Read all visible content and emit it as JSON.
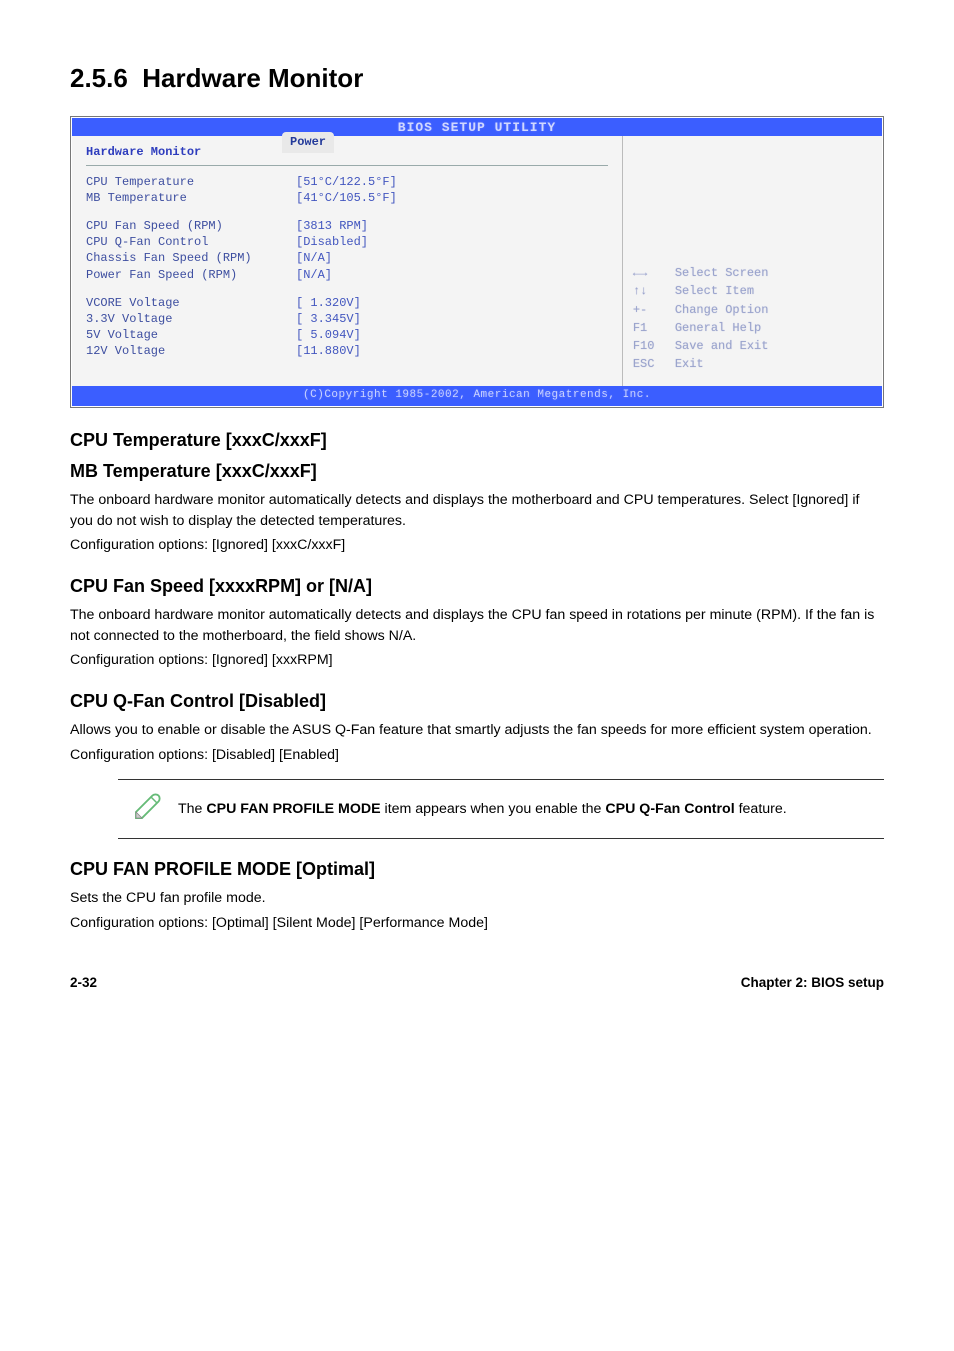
{
  "section": {
    "number": "2.5.6",
    "title": "Hardware Monitor"
  },
  "bios": {
    "header_title": "BIOS SETUP UTILITY",
    "tab_label": "Power",
    "menu_title": "Hardware Monitor",
    "block1": [
      {
        "label": "CPU Temperature",
        "value": "[51°C/122.5°F]"
      },
      {
        "label": "MB Temperature",
        "value": "[41°C/105.5°F]"
      }
    ],
    "block2": [
      {
        "label": "CPU Fan Speed (RPM)",
        "value": "[3813 RPM]"
      },
      {
        "label": "CPU Q-Fan Control",
        "value": "[Disabled]"
      },
      {
        "label": "Chassis Fan Speed (RPM)",
        "value": "[N/A]"
      },
      {
        "label": "Power Fan Speed (RPM)",
        "value": "[N/A]"
      }
    ],
    "block3": [
      {
        "label": "VCORE Voltage",
        "value": "[ 1.320V]"
      },
      {
        "label": "3.3V Voltage",
        "value": "[ 3.345V]"
      },
      {
        "label": "5V Voltage",
        "value": "[ 5.094V]"
      },
      {
        "label": "12V Voltage",
        "value": "[11.880V]"
      }
    ],
    "help": [
      {
        "key": "←→",
        "text": "Select Screen"
      },
      {
        "key": "↑↓",
        "text": "Select Item"
      },
      {
        "key": "+-",
        "text": "Change Option"
      },
      {
        "key": "F1",
        "text": "General Help"
      },
      {
        "key": "F10",
        "text": "Save and Exit"
      },
      {
        "key": "ESC",
        "text": "Exit"
      }
    ],
    "footer": "(C)Copyright 1985-2002, American Megatrends, Inc."
  },
  "sub1": {
    "head1": "CPU Temperature [xxxC/xxxF]",
    "head2": "MB Temperature [xxxC/xxxF]",
    "p1": "The onboard hardware monitor automatically detects and displays the motherboard and CPU temperatures. Select [Ignored] if you do not wish to display the detected temperatures.",
    "p2": "Configuration options: [Ignored] [xxxC/xxxF]"
  },
  "sub2": {
    "head": "CPU Fan Speed [xxxxRPM] or [N/A]",
    "p1": "The onboard hardware monitor automatically detects and displays the CPU fan speed in rotations per minute (RPM). If the fan is not connected to the motherboard, the field shows N/A.",
    "p2": "Configuration options: [Ignored] [xxxRPM]"
  },
  "sub3": {
    "head": "CPU Q-Fan Control [Disabled]",
    "p1": "Allows you to enable or disable the ASUS Q-Fan feature that smartly adjusts the fan speeds for more efficient system operation.",
    "p2": "Configuration options: [Disabled] [Enabled]"
  },
  "note": {
    "text_prefix": "The ",
    "bold1": "CPU FAN PROFILE MODE",
    "text_mid": " item appears when you enable the ",
    "bold2": "CPU Q-Fan Control",
    "text_suffix": " feature."
  },
  "sub4": {
    "head": "CPU FAN PROFILE MODE [Optimal]",
    "p1": "Sets the CPU fan profile mode.",
    "p2": "Configuration options: [Optimal] [Silent Mode] [Performance Mode]"
  },
  "footer": {
    "left": "2-32",
    "right": "Chapter 2: BIOS setup"
  }
}
